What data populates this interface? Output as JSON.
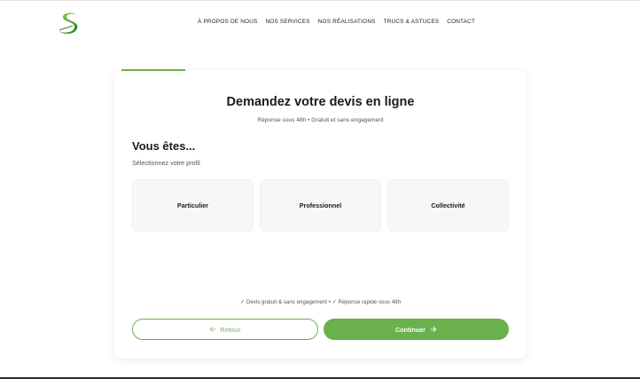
{
  "header": {
    "logo_icon": "s-leaf-logo-icon",
    "nav": [
      {
        "label": "À PROPOS DE NOUS"
      },
      {
        "label": "NOS SERVICES"
      },
      {
        "label": "NOS RÉALISATIONS"
      },
      {
        "label": "TRUCS & ASTUCES"
      },
      {
        "label": "CONTACT"
      }
    ]
  },
  "form": {
    "progress": 0.16,
    "title": "Demandez votre devis en ligne",
    "subtitle": "Réponse sous 48h • Gratuit et sans engagement",
    "step_title": "Vous êtes...",
    "step_subtitle": "Sélectionnez votre profil",
    "options": [
      {
        "label": "Particulier"
      },
      {
        "label": "Professionnel"
      },
      {
        "label": "Collectivité"
      }
    ],
    "reassurance": "✓ Devis gratuit & sans engagement • ✓ Réponse rapide sous 48h",
    "back_label": "Retour",
    "back_icon": "arrow-left-icon",
    "next_label": "Continuer",
    "next_icon": "arrow-right-icon"
  },
  "colors": {
    "accent": "#6ab04c",
    "option_bg": "#f5f8f4"
  }
}
